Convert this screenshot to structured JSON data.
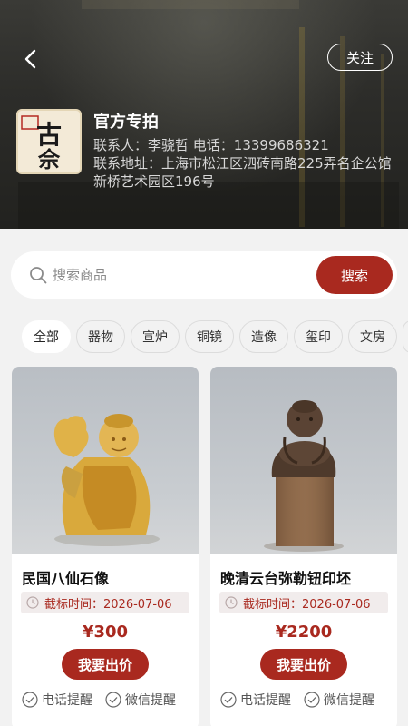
{
  "header": {
    "back_icon": "chevron-left-icon",
    "follow_label": "关注",
    "logo_text": [
      "古",
      "佘"
    ],
    "shop_name": "官方专拍",
    "contact_line": "联系人：李骁哲 电话：13399686321",
    "address_line": "联系地址：上海市松江区泗砖南路225弄名企公馆新桥艺术园区196号"
  },
  "search": {
    "placeholder": "搜索商品",
    "value": "",
    "button_label": "搜索",
    "icon": "search-icon"
  },
  "categories": [
    "全部",
    "器物",
    "宣炉",
    "铜镜",
    "造像",
    "玺印",
    "文房"
  ],
  "active_category": "全部",
  "products": [
    {
      "title": "民国八仙石像",
      "deadline": "截标时间：2026-07-06",
      "price": "¥300",
      "bid_label": "我要出价",
      "reminders": [
        "电话提醒",
        "微信提醒"
      ]
    },
    {
      "title": "晚清云台弥勒钮印坯",
      "deadline": "截标时间：2026-07-06",
      "price": "¥2200",
      "bid_label": "我要出价",
      "reminders": [
        "电话提醒",
        "微信提醒"
      ]
    }
  ],
  "colors": {
    "accent": "#a9291f",
    "header_bg": "#2d2d2a",
    "page_bg": "#f2f2f2"
  }
}
